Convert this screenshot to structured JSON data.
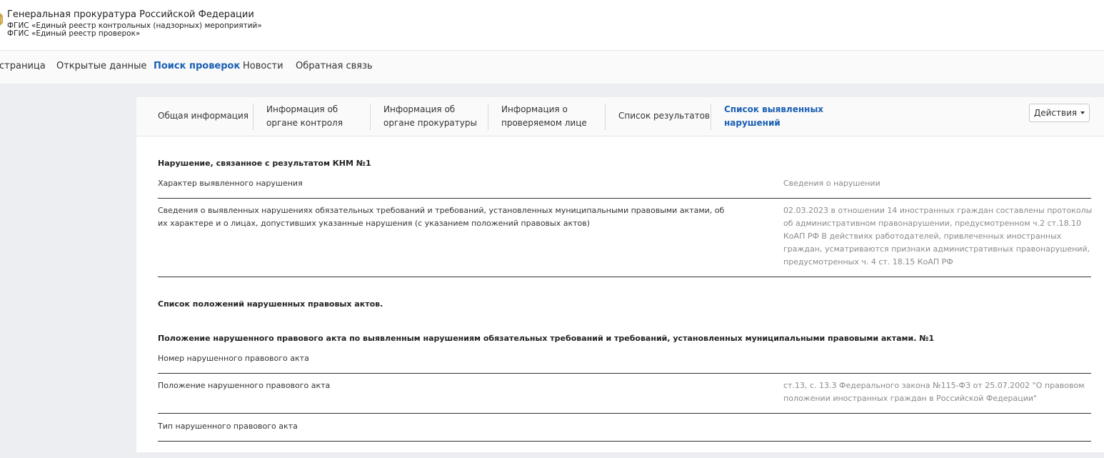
{
  "header": {
    "org_title": "Генеральная прокуратура Российской Федерации",
    "system_line_1": "ФГИС «Единый реестр контрольных (надзорных) мероприятий»",
    "system_line_2": "ФГИС «Единый реестр проверок»",
    "emblem_icon": "emblem-icon"
  },
  "nav": {
    "items": [
      {
        "label": "страница"
      },
      {
        "label": "Открытые данные"
      },
      {
        "label": "Поиск проверок",
        "active": true
      },
      {
        "label": "Новости"
      },
      {
        "label": "Обратная связь"
      }
    ]
  },
  "tabs": {
    "items": [
      {
        "line1": "Общая информация",
        "line2": ""
      },
      {
        "line1": "Информация об",
        "line2": "органе контроля"
      },
      {
        "line1": "Информация об",
        "line2": "органе прокуратуры"
      },
      {
        "line1": "Информация о",
        "line2": "проверяемом лице"
      },
      {
        "line1": "Список результатов",
        "line2": ""
      },
      {
        "line1": "Список выявленных",
        "line2": "нарушений",
        "active": true
      }
    ],
    "actions_label": "Действия",
    "actions_icon": "caret-down-icon"
  },
  "violation": {
    "title": "Нарушение, связанное с результатом КНМ №1",
    "col_left_header": "Характер выявленного нарушения",
    "col_right_header": "Сведения о нарушении",
    "row_label": "Сведения о выявленных нарушениях обязательных требований и требований, установленных муниципальными правовыми актами, об их характере и о лицах, допустивших указанные нарушения (с указанием положений правовых актов)",
    "row_value": "02.03.2023 в отношении 14 иностранных граждан составлены протоколы об административном правонарушении, предусмотренном ч.2 ст.18.10 КоАП РФ В действиях работодателей, привлеченных иностранных граждан, усматриваются признаки административных правонарушений, предусмотренных ч. 4 ст. 18.15 КоАП РФ"
  },
  "provisions": {
    "list_title": "Список положений нарушенных правовых актов.",
    "item_title": "Положение нарушенного правового акта по выявленным нарушениям обязательных требований и требований, установленных муниципальными правовыми актами. №1",
    "number_label": "Номер нарушенного правового акта",
    "position_label": "Положение нарушенного правового акта",
    "position_value": "ст.13, с. 13.3 Федерального закона №115-ФЗ от 25.07.2002 \"О правовом положении иностранных граждан в Российской Федерации\"",
    "type_label": "Тип нарушенного правового акта"
  }
}
